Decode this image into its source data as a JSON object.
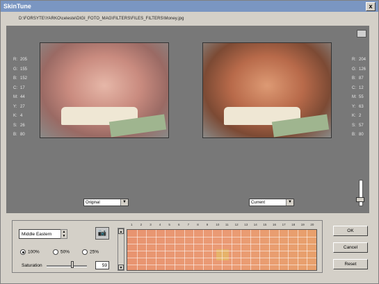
{
  "window": {
    "title": "SkinTune",
    "close_label": "x"
  },
  "file_path": "D:\\FORSYTE\\YARKO\\celeste\\DIGI_FOTO_MAG\\FILTERS\\FILES_FILTERS\\Money.jpg",
  "left_stats": [
    {
      "label": "R:",
      "value": "205"
    },
    {
      "label": "G:",
      "value": "155"
    },
    {
      "label": "B:",
      "value": "152"
    },
    {
      "label": "C:",
      "value": "17"
    },
    {
      "label": "M:",
      "value": "44"
    },
    {
      "label": "Y:",
      "value": "27"
    },
    {
      "label": "K:",
      "value": "4"
    },
    {
      "label": "S:",
      "value": "26"
    },
    {
      "label": "B:",
      "value": "80"
    }
  ],
  "right_stats": [
    {
      "label": "R:",
      "value": "204"
    },
    {
      "label": "G:",
      "value": "126"
    },
    {
      "label": "B:",
      "value": "87"
    },
    {
      "label": "C:",
      "value": "12"
    },
    {
      "label": "M:",
      "value": "55"
    },
    {
      "label": "Y:",
      "value": "63"
    },
    {
      "label": "K:",
      "value": "2"
    },
    {
      "label": "S:",
      "value": "57"
    },
    {
      "label": "B:",
      "value": "80"
    }
  ],
  "left_view": {
    "selected": "Original"
  },
  "right_view": {
    "selected": "Current"
  },
  "skin_type": {
    "selected": "Middle Eastern"
  },
  "radios": [
    {
      "label": "100%",
      "checked": true
    },
    {
      "label": "50%",
      "checked": false
    },
    {
      "label": "25%",
      "checked": false
    }
  ],
  "saturation": {
    "label": "Saturation",
    "value": "59"
  },
  "grid": {
    "column_labels": [
      "1",
      "2",
      "3",
      "4",
      "5",
      "6",
      "7",
      "8",
      "9",
      "10",
      "11",
      "12",
      "13",
      "14",
      "15",
      "16",
      "17",
      "18",
      "19",
      "20"
    ]
  },
  "buttons": {
    "ok": "OK",
    "cancel": "Cancel",
    "reset": "Reset"
  }
}
